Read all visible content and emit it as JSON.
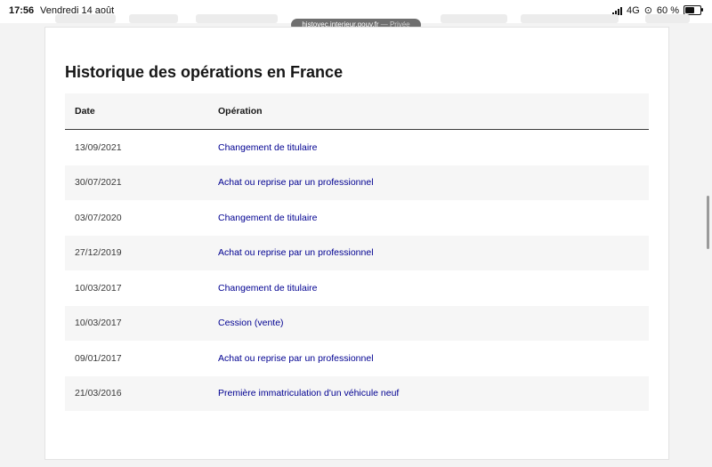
{
  "status_bar": {
    "time": "17:56",
    "date": "Vendredi 14 août",
    "network": "4G",
    "battery": "60 %",
    "battery_level": 0.6
  },
  "browser": {
    "url": "histovec.interieur.gouv.fr",
    "mode": "— Privée"
  },
  "page": {
    "title": "Historique des opérations en France"
  },
  "table": {
    "headers": {
      "date": "Date",
      "operation": "Opération"
    },
    "rows": [
      {
        "date": "13/09/2021",
        "operation": "Changement de titulaire"
      },
      {
        "date": "30/07/2021",
        "operation": "Achat ou reprise par un professionnel"
      },
      {
        "date": "03/07/2020",
        "operation": "Changement de titulaire"
      },
      {
        "date": "27/12/2019",
        "operation": "Achat ou reprise par un professionnel"
      },
      {
        "date": "10/03/2017",
        "operation": "Changement de titulaire"
      },
      {
        "date": "10/03/2017",
        "operation": "Cession (vente)"
      },
      {
        "date": "09/01/2017",
        "operation": "Achat ou reprise par un professionnel"
      },
      {
        "date": "21/03/2016",
        "operation": "Première immatriculation d'un véhicule neuf"
      }
    ]
  },
  "colors": {
    "link": "#000091",
    "text": "#161616",
    "stripe": "#f6f6f6"
  }
}
